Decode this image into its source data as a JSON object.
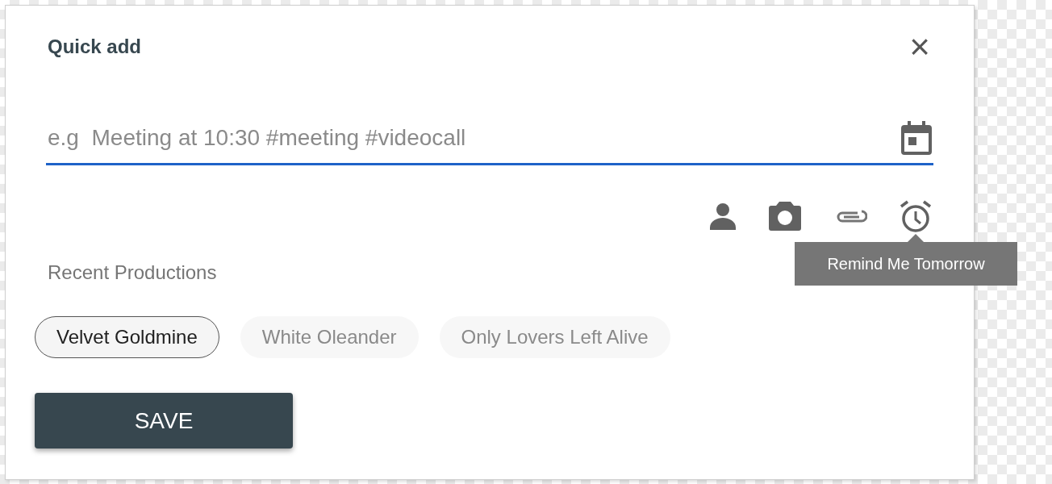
{
  "dialog": {
    "title": "Quick add",
    "close_icon": "×"
  },
  "input": {
    "placeholder": "e.g  Meeting at 10:30 #meeting #videocall"
  },
  "tooltip": {
    "text": "Remind Me Tomorrow"
  },
  "recent": {
    "heading": "Recent Productions",
    "chips": [
      {
        "label": "Velvet Goldmine",
        "selected": true
      },
      {
        "label": "White Oleander",
        "selected": false
      },
      {
        "label": "Only Lovers Left Alive",
        "selected": false
      }
    ]
  },
  "buttons": [
    {
      "label": "SAVE"
    }
  ]
}
